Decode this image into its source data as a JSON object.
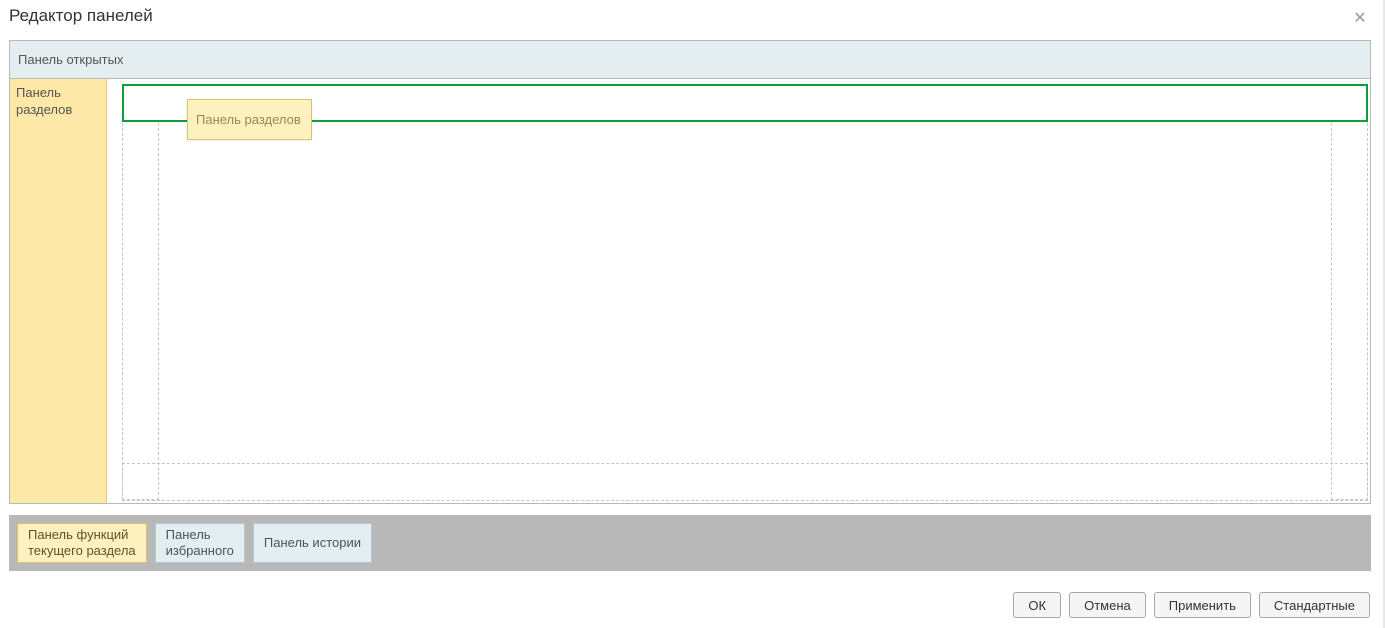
{
  "window": {
    "title": "Редактор панелей"
  },
  "layout": {
    "top_strip_label": "Панель открытых",
    "left_sidebar_label": "Панель разделов"
  },
  "drag": {
    "ghost_label": "Панель разделов"
  },
  "palette": {
    "chips": [
      {
        "id": "functions",
        "line1": "Панель функций",
        "line2": "текущего раздела",
        "style": "yellow"
      },
      {
        "id": "favorites",
        "line1": "Панель",
        "line2": "избранного",
        "style": "blue"
      },
      {
        "id": "history",
        "line1": "Панель истории",
        "line2": "",
        "style": "blue"
      }
    ]
  },
  "footer": {
    "ok": "ОК",
    "cancel": "Отмена",
    "apply": "Применить",
    "standard": "Стандартные"
  }
}
